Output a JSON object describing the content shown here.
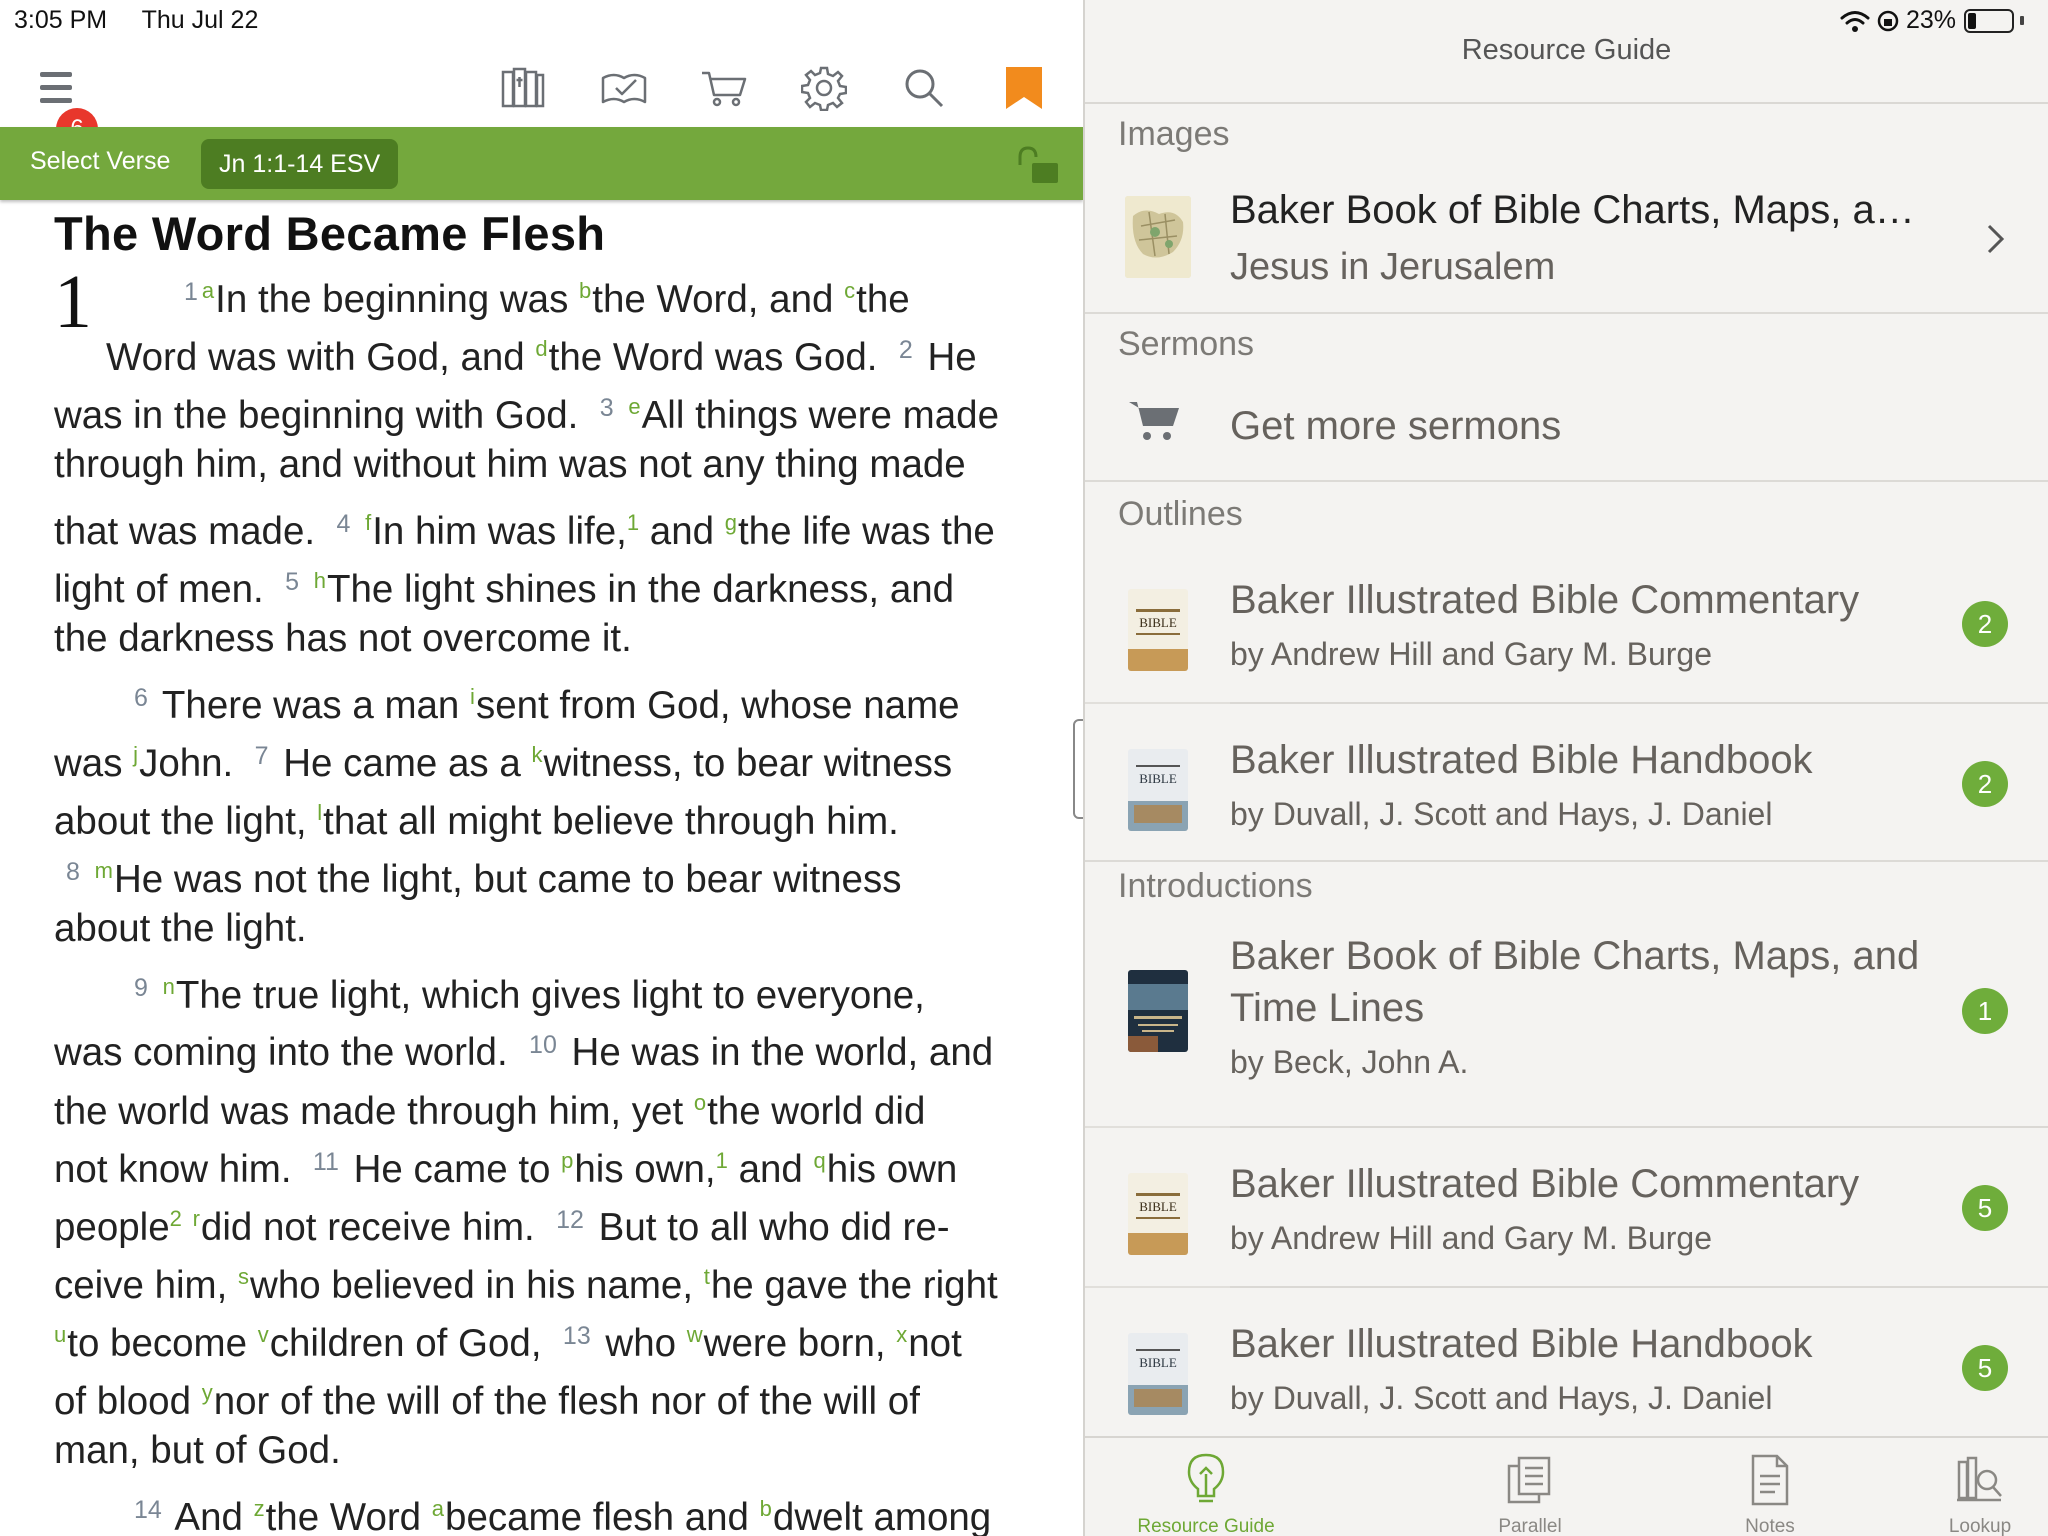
{
  "status": {
    "time": "3:05 PM",
    "date": "Thu Jul 22",
    "battery": "23%"
  },
  "toolbar": {
    "notification_count": "6"
  },
  "verse_bar": {
    "select_label": "Select Verse",
    "reference": "Jn 1:1-14 ESV"
  },
  "passage": {
    "heading": "The Word Became Flesh",
    "chapter": "1",
    "lines": [
      [
        [
          "vn",
          "1"
        ],
        [
          "cr",
          "a"
        ],
        [
          "t",
          "In the beginning was "
        ],
        [
          "cr",
          "b"
        ],
        [
          "t",
          "the Word, and "
        ],
        [
          "cr",
          "c"
        ],
        [
          "t",
          "the"
        ]
      ],
      [
        [
          "t",
          "Word was with God, and "
        ],
        [
          "cr",
          "d"
        ],
        [
          "t",
          "the Word was God.  "
        ],
        [
          "vn",
          "2"
        ],
        [
          "t",
          " He"
        ]
      ],
      [
        [
          "t",
          "was in the beginning with God.  "
        ],
        [
          "vn",
          "3"
        ],
        [
          "t",
          " "
        ],
        [
          "cr",
          "e"
        ],
        [
          "t",
          "All things were made"
        ]
      ],
      [
        [
          "t",
          "through him, and without him was not any thing made"
        ]
      ],
      [
        [
          "t",
          "that was made.  "
        ],
        [
          "vn",
          "4"
        ],
        [
          "t",
          " "
        ],
        [
          "cr",
          "f"
        ],
        [
          "t",
          "In him was life,"
        ],
        [
          "fn",
          "1"
        ],
        [
          "t",
          " and "
        ],
        [
          "cr",
          "g"
        ],
        [
          "t",
          "the life was the"
        ]
      ],
      [
        [
          "t",
          "light of men.  "
        ],
        [
          "vn",
          "5"
        ],
        [
          "t",
          " "
        ],
        [
          "cr",
          "h"
        ],
        [
          "t",
          "The light shines in the darkness, and"
        ]
      ],
      [
        [
          "t",
          "the darkness has not overcome it."
        ]
      ],
      [
        [
          "vn",
          "6"
        ],
        [
          "t",
          " There was a man "
        ],
        [
          "cr",
          "i"
        ],
        [
          "t",
          "sent from God, whose name"
        ]
      ],
      [
        [
          "t",
          "was "
        ],
        [
          "cr",
          "j"
        ],
        [
          "t",
          "John.  "
        ],
        [
          "vn",
          "7"
        ],
        [
          "t",
          " He came as a "
        ],
        [
          "cr",
          "k"
        ],
        [
          "t",
          "witness, to bear witness"
        ]
      ],
      [
        [
          "t",
          "about the light, "
        ],
        [
          "cr",
          "l"
        ],
        [
          "t",
          "that all might believe through him."
        ]
      ],
      [
        [
          "vn",
          "8"
        ],
        [
          "t",
          " "
        ],
        [
          "cr",
          "m"
        ],
        [
          "t",
          "He was not the light, but came to bear witness"
        ]
      ],
      [
        [
          "t",
          "about the light."
        ]
      ],
      [
        [
          "vn",
          "9"
        ],
        [
          "t",
          " "
        ],
        [
          "cr",
          "n"
        ],
        [
          "t",
          "The true light, which gives light to everyone,"
        ]
      ],
      [
        [
          "t",
          "was coming into the world.  "
        ],
        [
          "vn",
          "10"
        ],
        [
          "t",
          " He was in the world, and"
        ]
      ],
      [
        [
          "t",
          "the world was made through him, yet "
        ],
        [
          "cr",
          "o"
        ],
        [
          "t",
          "the world did"
        ]
      ],
      [
        [
          "t",
          "not know him.  "
        ],
        [
          "vn",
          "11"
        ],
        [
          "t",
          " He came to "
        ],
        [
          "cr",
          "p"
        ],
        [
          "t",
          "his own,"
        ],
        [
          "fn",
          "1"
        ],
        [
          "t",
          " and "
        ],
        [
          "cr",
          "q"
        ],
        [
          "t",
          "his own"
        ]
      ],
      [
        [
          "t",
          "people"
        ],
        [
          "fn",
          "2"
        ],
        [
          "t",
          " "
        ],
        [
          "cr",
          "r"
        ],
        [
          "t",
          "did not receive him.  "
        ],
        [
          "vn",
          "12"
        ],
        [
          "t",
          " But to all who did re-"
        ]
      ],
      [
        [
          "t",
          "ceive him, "
        ],
        [
          "cr",
          "s"
        ],
        [
          "t",
          "who believed in his name, "
        ],
        [
          "cr",
          "t"
        ],
        [
          "t",
          "he gave the right"
        ]
      ],
      [
        [
          "cr",
          "u"
        ],
        [
          "t",
          "to become "
        ],
        [
          "cr",
          "v"
        ],
        [
          "t",
          "children of God,  "
        ],
        [
          "vn",
          "13"
        ],
        [
          "t",
          " who "
        ],
        [
          "cr",
          "w"
        ],
        [
          "t",
          "were born, "
        ],
        [
          "cr",
          "x"
        ],
        [
          "t",
          "not"
        ]
      ],
      [
        [
          "t",
          "of blood "
        ],
        [
          "cr",
          "y"
        ],
        [
          "t",
          "nor of the will of the flesh nor of the will of"
        ]
      ],
      [
        [
          "t",
          "man, but of God."
        ]
      ],
      [
        [
          "vn",
          "14"
        ],
        [
          "t",
          " And "
        ],
        [
          "cr",
          "z"
        ],
        [
          "t",
          "the Word "
        ],
        [
          "cr",
          "a"
        ],
        [
          "t",
          "became flesh and "
        ],
        [
          "cr",
          "b"
        ],
        [
          "t",
          "dwelt among"
        ]
      ]
    ]
  },
  "resource_guide": {
    "title": "Resource Guide",
    "sections": {
      "images": {
        "header": "Images",
        "title": "Baker Book of Bible Charts, Maps, and T…",
        "subtitle": "Jesus in Jerusalem"
      },
      "sermons": {
        "header": "Sermons",
        "action": "Get more sermons"
      },
      "outlines": {
        "header": "Outlines",
        "items": [
          {
            "title": "Baker Illustrated Bible Commentary",
            "author": "by Andrew Hill and Gary M. Burge",
            "count": "2"
          },
          {
            "title": "Baker Illustrated Bible Handbook",
            "author": "by Duvall, J. Scott and Hays, J. Daniel",
            "count": "2"
          }
        ]
      },
      "introductions": {
        "header": "Introductions",
        "items": [
          {
            "title": "Baker Book of Bible Charts, Maps, and Time Lines",
            "author": "by Beck, John A.",
            "count": "1"
          },
          {
            "title": "Baker Illustrated Bible Commentary",
            "author": "by Andrew Hill and Gary M. Burge",
            "count": "5"
          },
          {
            "title": "Baker Illustrated Bible Handbook",
            "author": "by Duvall, J. Scott and Hays, J. Daniel",
            "count": "5"
          }
        ]
      }
    },
    "tabs": [
      "Resource Guide",
      "Parallel",
      "Notes",
      "Lookup"
    ]
  },
  "colors": {
    "accent_green": "#74a83d",
    "badge_red": "#e8372c",
    "bookmark_orange": "#f28b1d"
  }
}
